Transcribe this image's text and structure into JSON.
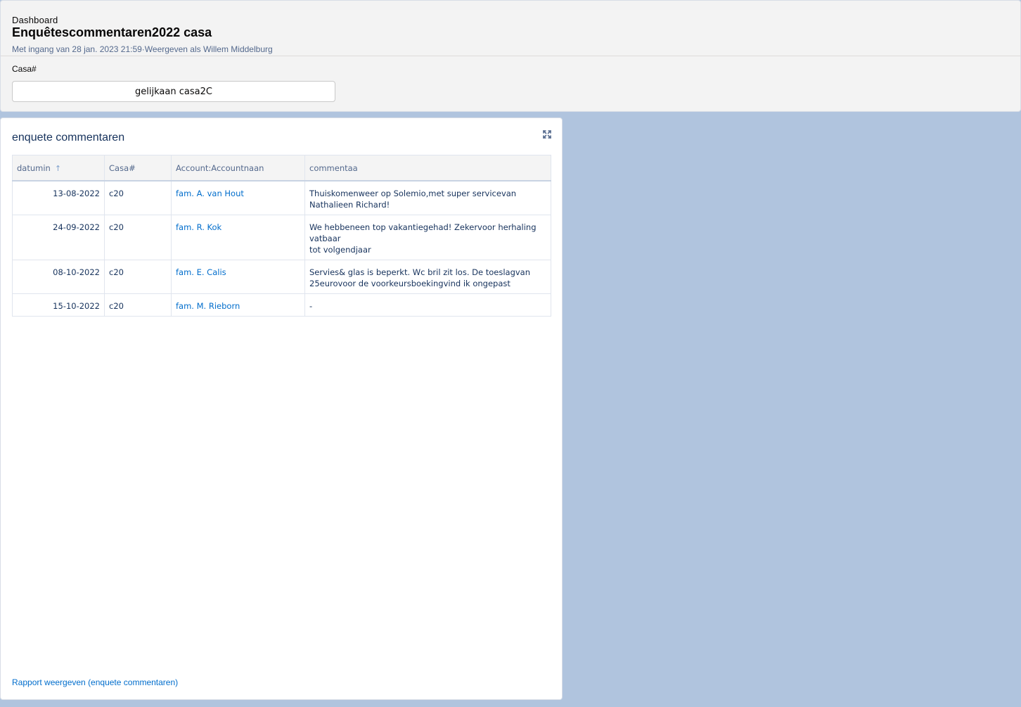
{
  "header": {
    "eyebrow": "Dashboard",
    "title": "Enquêtescommentaren2022 casa",
    "meta": "Met ingang van 28 jan. 2023 21:59·Weergeven als Willem Middelburg",
    "filter_label": "Casa#",
    "filter_value": "gelijkaan casa2C"
  },
  "panel": {
    "title": "enquete commentaren",
    "expand_icon": "expand-icon",
    "columns": [
      "datumin",
      "Casa#",
      "Account:Accountnaan",
      "commentaa"
    ],
    "sort_icon": "↑",
    "rows": [
      {
        "date": "13-08-2022",
        "casa": "c20",
        "account": "fam. A. van Hout",
        "comment": [
          "Thuiskomenweer op Solemio,met super servicevan",
          "Nathalieen Richard!"
        ]
      },
      {
        "date": "24-09-2022",
        "casa": "c20",
        "account": "fam. R. Kok",
        "comment": [
          "We hebbeneen top vakantiegehad! Zekervoor herhaling vatbaar",
          "tot volgendjaar"
        ]
      },
      {
        "date": "08-10-2022",
        "casa": "c20",
        "account": "fam. E. Calis",
        "comment": [
          "Servies& glas is beperkt. Wc bril zit los. De toeslagvan",
          "25eurovoor de voorkeursboekingvind ik ongepast"
        ]
      },
      {
        "date": "15-10-2022",
        "casa": "c20",
        "account": "fam. M. Rieborn",
        "comment": [
          "-"
        ]
      }
    ],
    "report_link": "Rapport weergeven (enquete commentaren)"
  }
}
